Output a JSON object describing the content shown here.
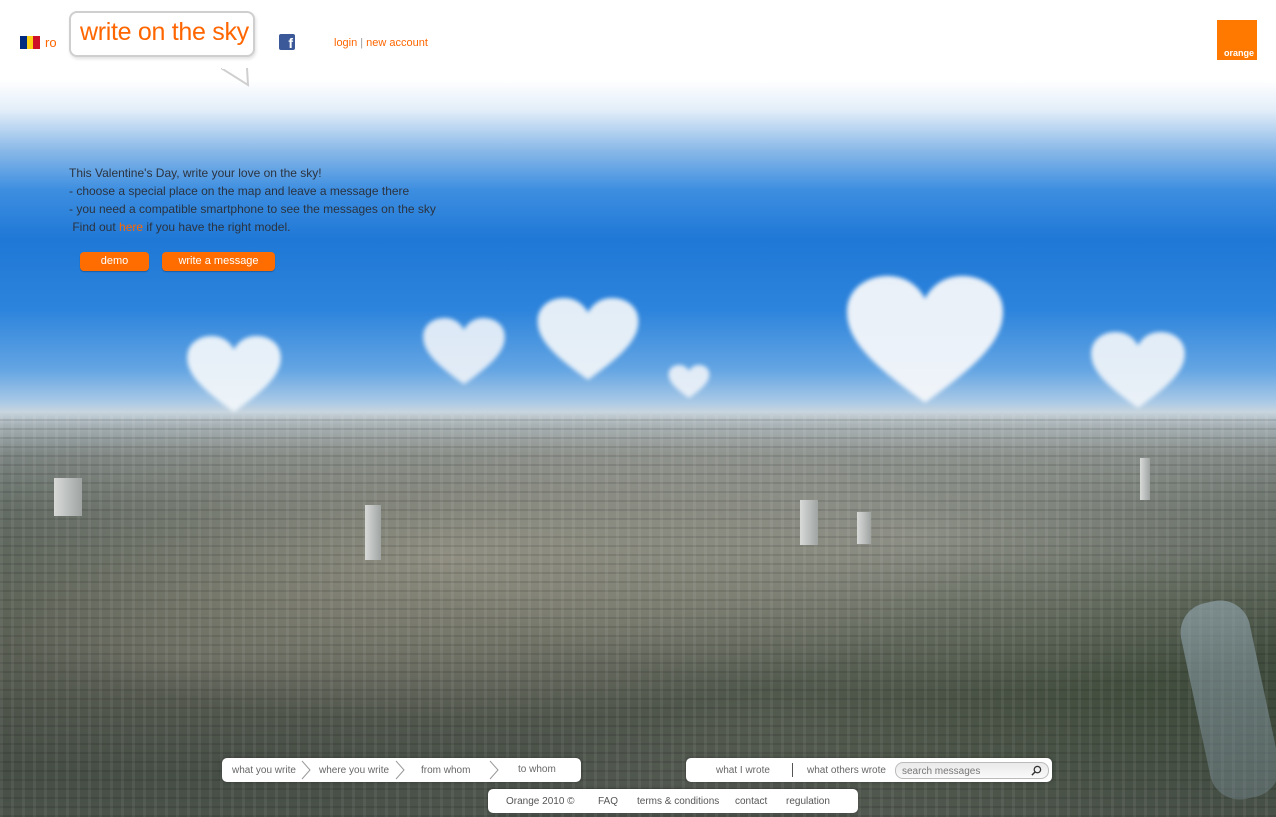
{
  "header": {
    "language_code": "ro",
    "logo_text": "write on the sky",
    "login_label": "login",
    "separator": "|",
    "new_account_label": "new account",
    "brand_label": "orange"
  },
  "intro": {
    "headline": "This Valentine's Day, write your love on the sky!",
    "bullet_1": " - choose a special place on the map and leave a message there",
    "bullet_2": " - you need a compatible smartphone to see the messages on the sky",
    "find_prefix": " Find out ",
    "find_link": "here",
    "find_suffix": " if you have the right model."
  },
  "buttons": {
    "demo_label": "demo",
    "write_label": "write a message"
  },
  "steps": [
    {
      "label": "what you write"
    },
    {
      "label": "where you write"
    },
    {
      "label": "from whom"
    },
    {
      "label": "to whom"
    }
  ],
  "messages": {
    "mine_label": "what I wrote",
    "others_label": "what others wrote",
    "search_placeholder": "search messages"
  },
  "footer": {
    "copyright": "Orange 2010 ©",
    "faq": "FAQ",
    "terms": "terms & conditions",
    "contact": "contact",
    "regulation": "regulation"
  },
  "colors": {
    "accent": "#ff6d00",
    "sky": "#1f78d6",
    "facebook": "#3b5998",
    "brand": "#ff7900"
  },
  "icons": [
    "romania-flag-icon",
    "facebook-icon",
    "chevron-right-icon",
    "search-icon",
    "orange-logo"
  ]
}
